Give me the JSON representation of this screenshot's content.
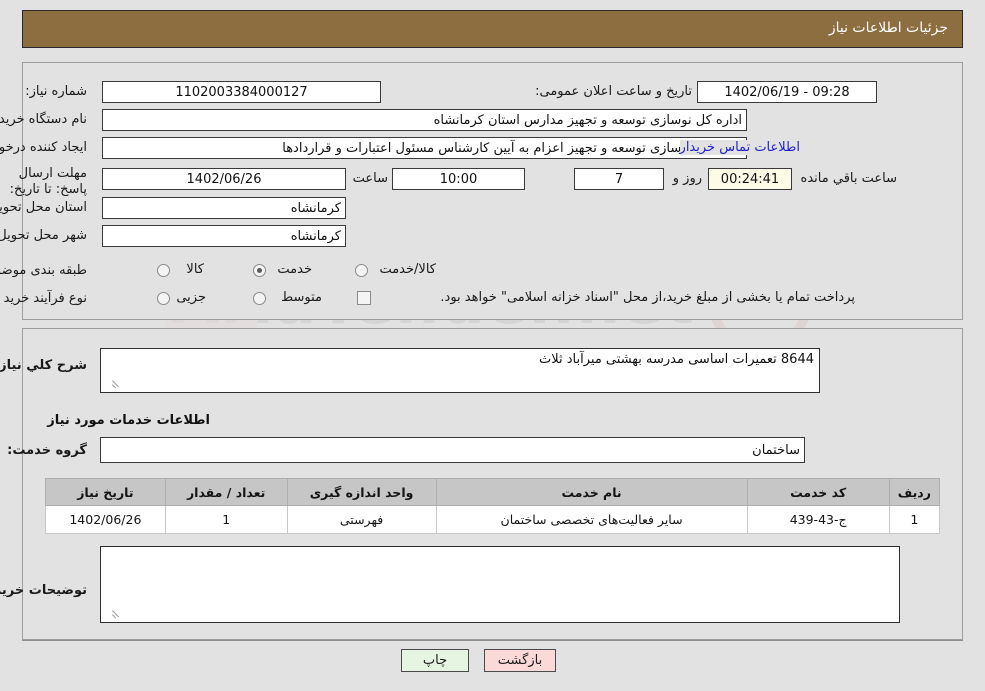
{
  "header": {
    "title": "جزئیات اطلاعات نیاز",
    "bar_color": "#8d6e41"
  },
  "watermark": {
    "text": "AriaTender.net"
  },
  "top_panel": {
    "need_number_label": "شماره نیاز:",
    "need_number_value": "1102003384000127",
    "announce_datetime_label": "تاریخ و ساعت اعلان عمومی:",
    "announce_datetime_value": "09:28 - 1402/06/19",
    "buyer_org_label": "نام دستگاه خریدار:",
    "buyer_org_value": "اداره کل نوسازی  توسعه و تجهیز مدارس استان کرمانشاه",
    "requester_label": "ایجاد کننده درخواست:",
    "requester_value": "اداره کل نوسازی  توسعه و تجهیز اعزام به آیین کارشناس مسئول اعتبارات و قراردادها",
    "buyer_contact_link": "اطلاعات تماس خریدار",
    "deadline_label": "مهلت ارسال پاسخ: تا تاریخ:",
    "deadline_date": "1402/06/26",
    "deadline_hour_label": "ساعت",
    "deadline_hour_value": "10:00",
    "remaining_days_value": "7",
    "remaining_days_label": "روز و",
    "remaining_timer_value": "00:24:41",
    "remaining_suffix_label": "ساعت باقي مانده",
    "province_label": "استان محل تحویل:",
    "province_value": "کرمانشاه",
    "city_label": "شهر محل تحویل:",
    "city_value": "کرمانشاه",
    "category_label": "طبقه بندی موضوعی:",
    "category_options": [
      {
        "label": "کالا",
        "selected": false
      },
      {
        "label": "خدمت",
        "selected": true
      },
      {
        "label": "کالا/خدمت",
        "selected": false
      }
    ],
    "process_label": "نوع فرآیند خرید :",
    "process_options": [
      {
        "label": "جزیی",
        "selected": false
      },
      {
        "label": "متوسط",
        "selected": false
      }
    ],
    "treasury_checkbox_label": "پرداخت تمام یا بخشی از مبلغ خرید،از محل \"اسناد خزانه اسلامی\" خواهد بود.",
    "treasury_checkbox_checked": false
  },
  "bottom_panel": {
    "general_desc_label": "شرح كلي نياز:",
    "general_desc_value": "8644 تعمیرات اساسی مدرسه بهشتی میرآباد ثلاث",
    "services_section_title": "اطلاعات خدمات مورد نیاز",
    "service_group_label": "گروه خدمت:",
    "service_group_value": "ساختمان",
    "table": {
      "columns": [
        "ردیف",
        "کد خدمت",
        "نام خدمت",
        "واحد اندازه گیری",
        "تعداد / مقدار",
        "تاریخ نیاز"
      ],
      "rows": [
        [
          "1",
          "ج-43-439",
          "سایر فعالیت‌های تخصصی ساختمان",
          "فهرستی",
          "1",
          "1402/06/26"
        ]
      ]
    },
    "buyer_notes_label": "توضیحات خریدار:",
    "buyer_notes_value": ""
  },
  "footer": {
    "print_button": "چاپ",
    "back_button": "بازگشت"
  }
}
